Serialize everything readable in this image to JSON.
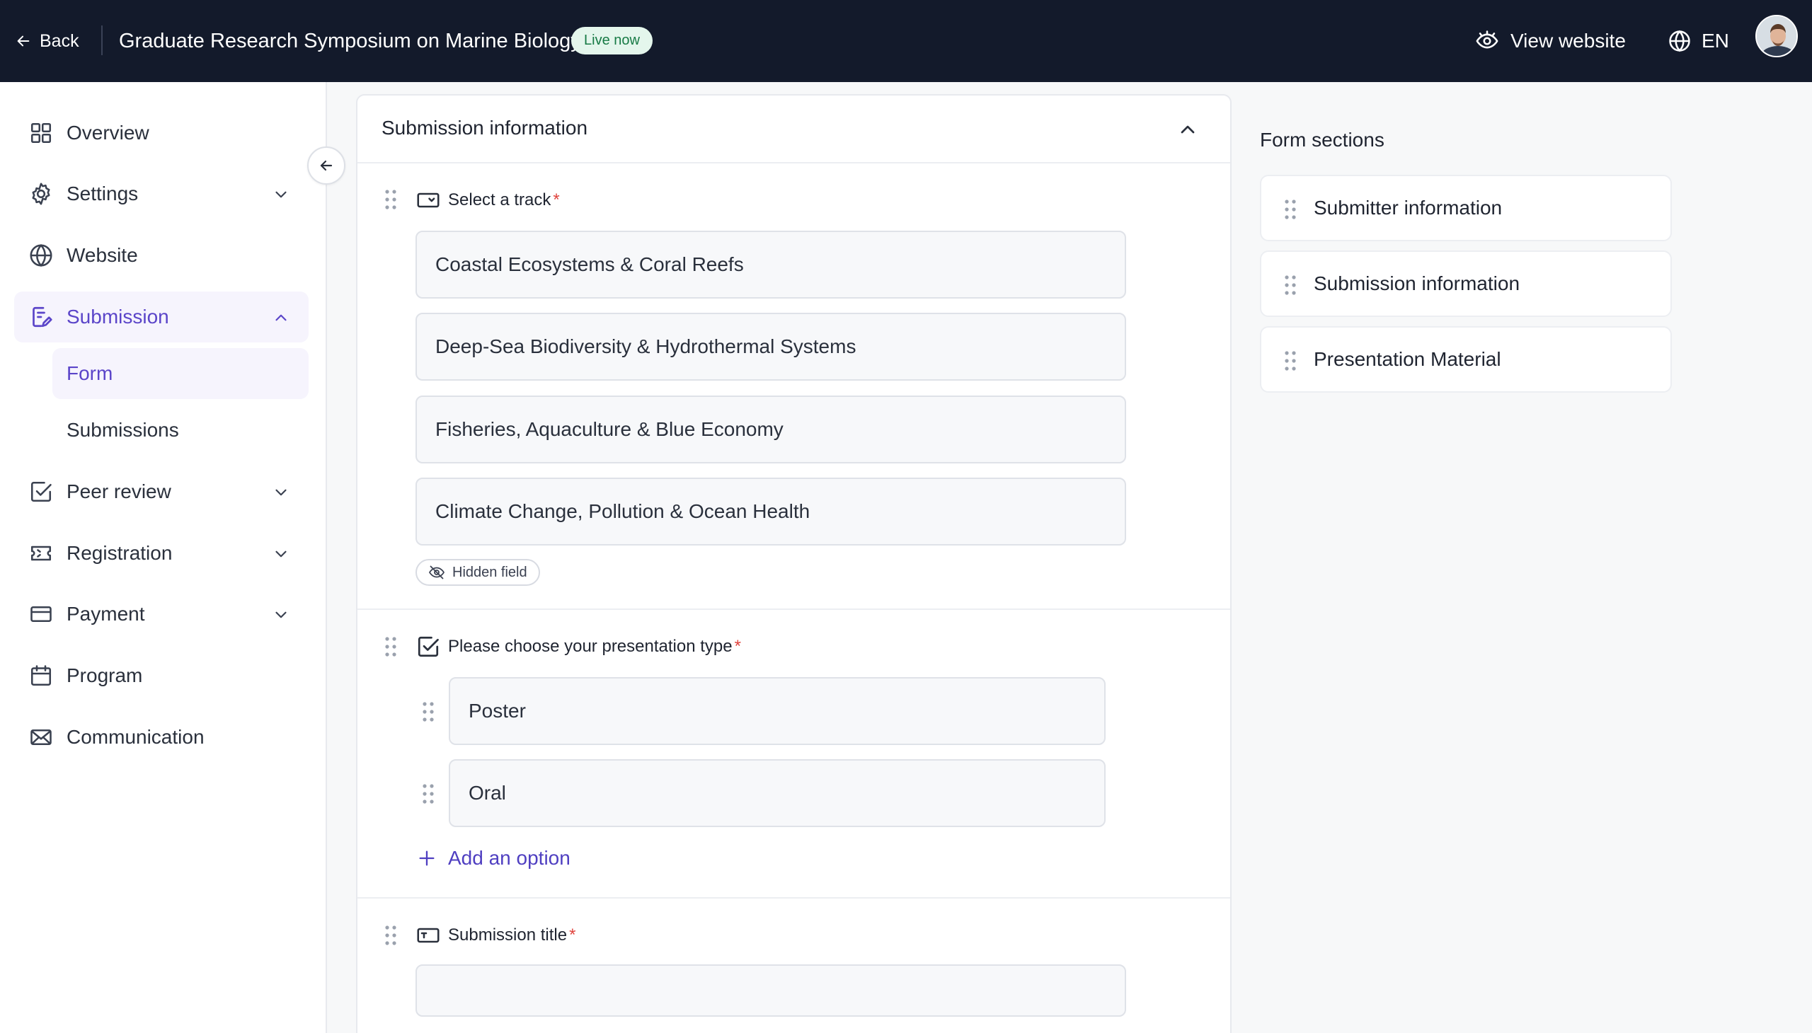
{
  "topbar": {
    "back_label": "Back",
    "event_title": "Graduate Research Symposium on Marine Biology",
    "status_badge": "Live now",
    "view_website_label": "View website",
    "language": "EN"
  },
  "sidebar": {
    "items": [
      {
        "label": "Overview",
        "icon": "grid-icon"
      },
      {
        "label": "Settings",
        "icon": "gear-icon"
      },
      {
        "label": "Website",
        "icon": "globe-icon"
      },
      {
        "label": "Submission",
        "icon": "submission-icon"
      },
      {
        "label": "Peer review",
        "icon": "check-square-icon"
      },
      {
        "label": "Registration",
        "icon": "ticket-icon"
      },
      {
        "label": "Payment",
        "icon": "card-icon"
      },
      {
        "label": "Program",
        "icon": "calendar-icon"
      },
      {
        "label": "Communication",
        "icon": "mail-icon"
      }
    ],
    "submission_sub": [
      {
        "label": "Form"
      },
      {
        "label": "Submissions"
      }
    ],
    "active_item": "Submission",
    "active_sub_item": "Form"
  },
  "form": {
    "section_title": "Submission information",
    "fields": {
      "track": {
        "label": "Select a track",
        "required_mark": "*",
        "options": [
          "Coastal Ecosystems & Coral Reefs",
          "Deep-Sea Biodiversity & Hydrothermal Systems",
          "Fisheries, Aquaculture & Blue Economy",
          "Climate Change, Pollution & Ocean Health"
        ],
        "hidden_chip": "Hidden field"
      },
      "presentation": {
        "label": "Please choose your presentation type",
        "required_mark": "*",
        "options": [
          "Poster",
          "Oral"
        ],
        "add_option_label": "Add an option"
      },
      "title": {
        "label": "Submission title",
        "required_mark": "*",
        "value": ""
      }
    }
  },
  "form_sections": {
    "title": "Form sections",
    "items": [
      "Submitter information",
      "Submission information",
      "Presentation Material"
    ]
  },
  "colors": {
    "topbar_bg": "#131a2b",
    "accent": "#5b45c9",
    "live_badge_bg": "#e4f6ec",
    "live_badge_text": "#177a45",
    "required": "#e0443e"
  }
}
